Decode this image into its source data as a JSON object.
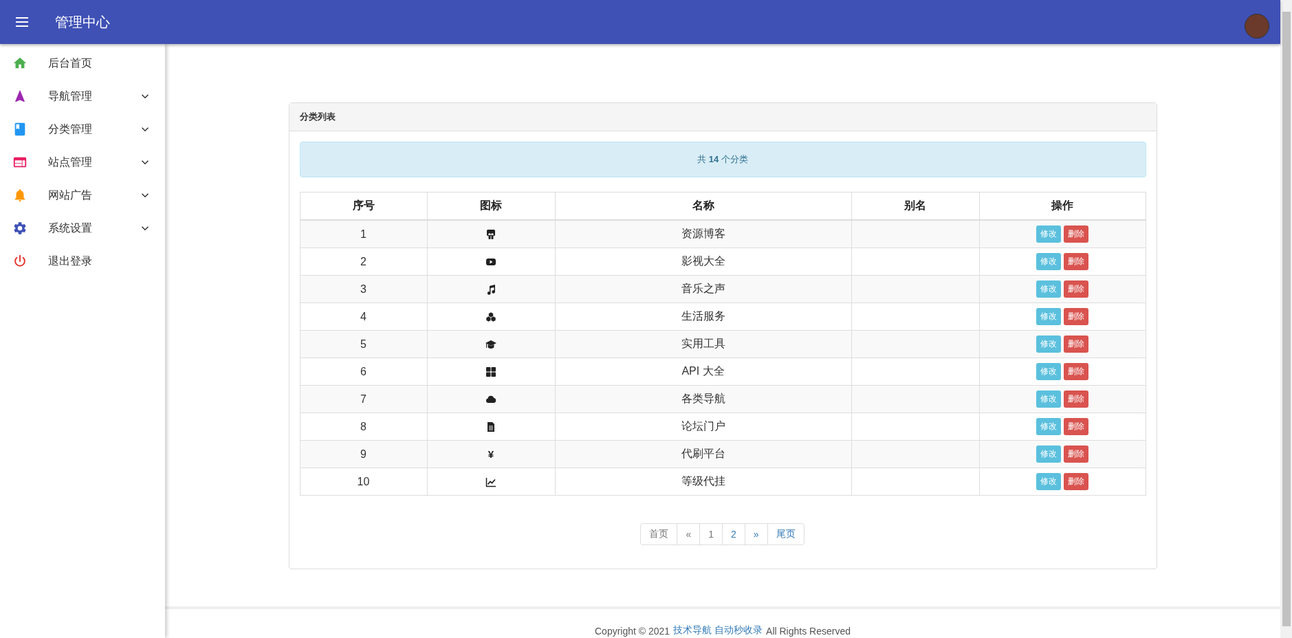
{
  "header": {
    "title": "管理中心"
  },
  "sidebar": {
    "items": [
      {
        "label": "后台首页",
        "kind": "home",
        "submenu": false
      },
      {
        "label": "导航管理",
        "kind": "navigation",
        "submenu": true
      },
      {
        "label": "分类管理",
        "kind": "book",
        "submenu": true
      },
      {
        "label": "站点管理",
        "kind": "web",
        "submenu": true
      },
      {
        "label": "网站广告",
        "kind": "bell",
        "submenu": true
      },
      {
        "label": "系统设置",
        "kind": "gear",
        "submenu": true
      },
      {
        "label": "退出登录",
        "kind": "power",
        "submenu": false
      }
    ]
  },
  "card": {
    "title": "分类列表",
    "summary": "共 **14** 个分类",
    "table": {
      "columns": [
        "序号",
        "图标",
        "名称",
        "别名",
        "操作"
      ],
      "rows": [
        {
          "index": "1",
          "kind": "presentation",
          "name": "资源博客",
          "actions": [
            "修改",
            "删除"
          ]
        },
        {
          "index": "2",
          "kind": "video",
          "name": "影视大全",
          "actions": [
            "修改",
            "删除"
          ]
        },
        {
          "index": "3",
          "kind": "music",
          "name": "音乐之声",
          "actions": [
            "修改",
            "删除"
          ]
        },
        {
          "index": "4",
          "kind": "cubes",
          "name": "生活服务",
          "actions": [
            "修改",
            "删除"
          ]
        },
        {
          "index": "5",
          "kind": "graduation",
          "name": "实用工具",
          "actions": [
            "修改",
            "删除"
          ]
        },
        {
          "index": "6",
          "kind": "grid",
          "name": "API 大全",
          "actions": [
            "修改",
            "删除"
          ]
        },
        {
          "index": "7",
          "kind": "cloud",
          "name": "各类导航",
          "actions": [
            "修改",
            "删除"
          ]
        },
        {
          "index": "8",
          "kind": "document",
          "name": "论坛门户",
          "actions": [
            "修改",
            "删除"
          ]
        },
        {
          "index": "9",
          "kind": "symbol",
          "symbol": "¥",
          "name": "代刷平台",
          "actions": [
            "修改",
            "删除"
          ]
        },
        {
          "index": "10",
          "kind": "chart",
          "name": "等级代挂",
          "actions": [
            "修改",
            "删除"
          ]
        }
      ]
    },
    "pagination": [
      {
        "label": "首页",
        "disabled": true
      },
      {
        "label": "«",
        "disabled": true
      },
      {
        "label": "1",
        "disabled": true
      },
      {
        "label": "2",
        "disabled": false
      },
      {
        "label": "»",
        "disabled": false
      },
      {
        "label": "尾页",
        "disabled": false
      }
    ]
  },
  "footer": {
    "prefix": "Copyright © 2021",
    "link": "技术导航 自动秒收录",
    "suffix": "All Rights Reserved"
  }
}
